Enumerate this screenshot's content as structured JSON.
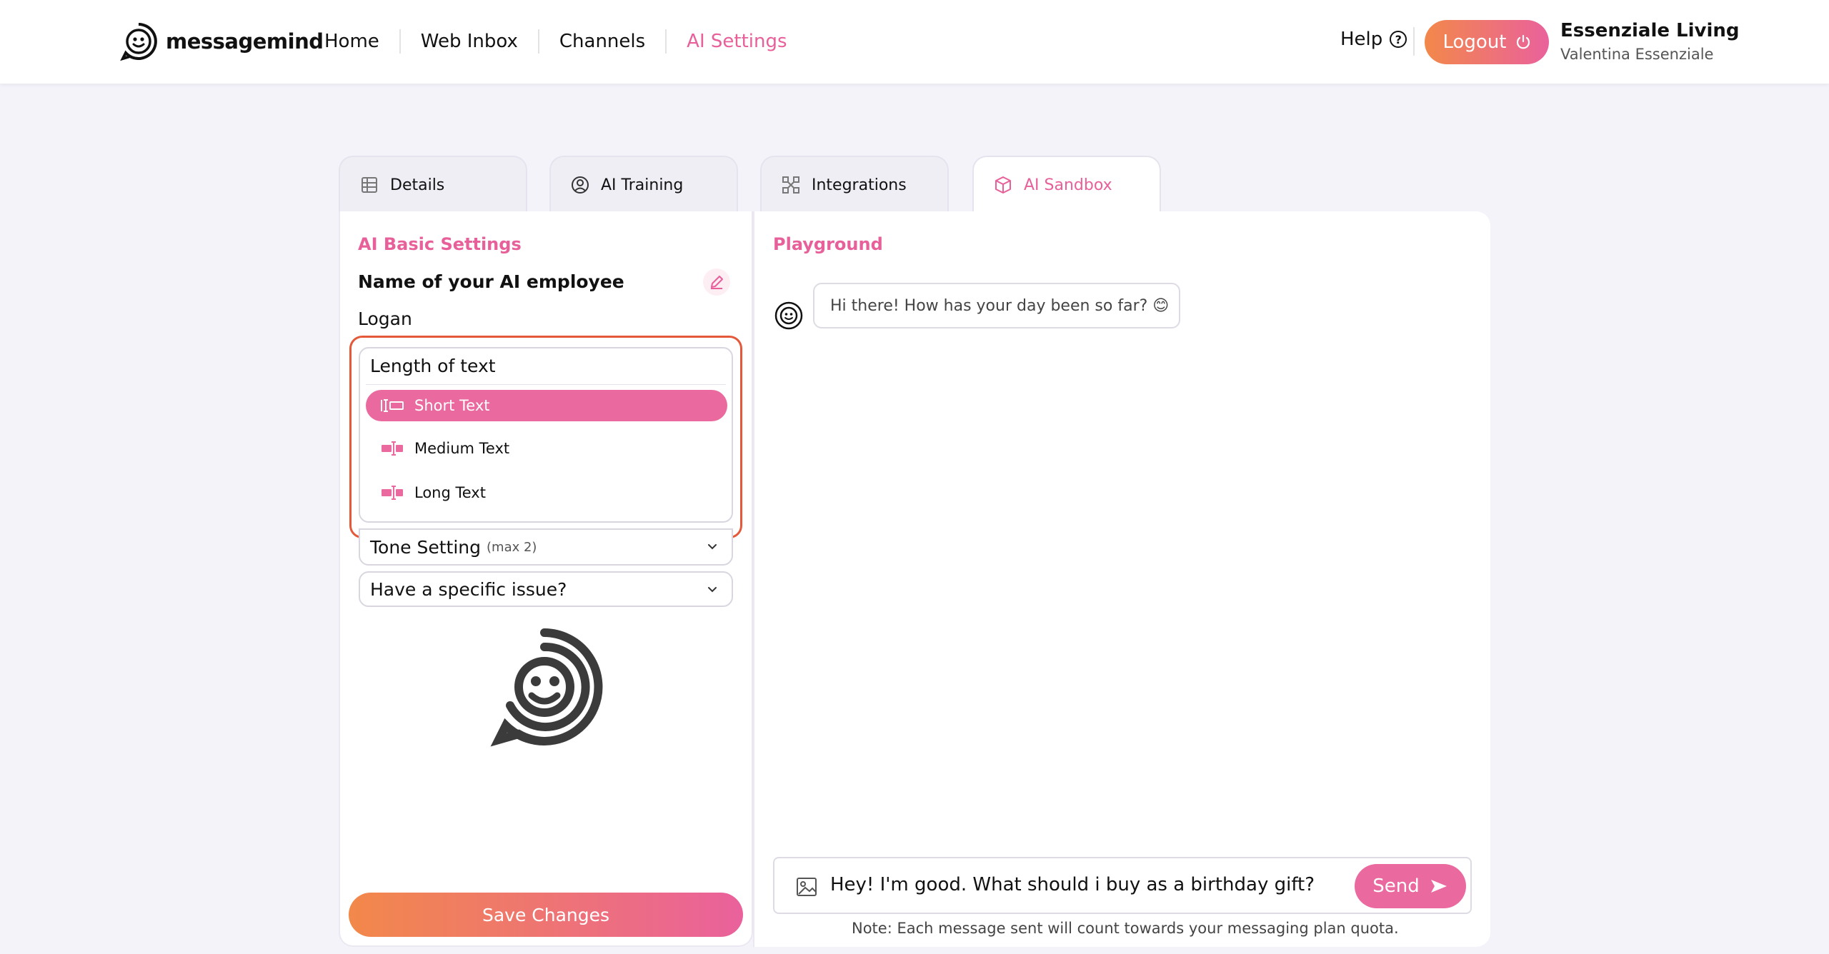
{
  "brand": {
    "name": "messagemind"
  },
  "nav": {
    "items": [
      "Home",
      "Web Inbox",
      "Channels",
      "AI Settings"
    ],
    "active": "AI Settings"
  },
  "header": {
    "help_label": "Help",
    "logout_label": "Logout",
    "user_company": "Essenziale Living",
    "user_name": "Valentina Essenziale"
  },
  "tabs": [
    {
      "label": "Details",
      "icon": "table-icon"
    },
    {
      "label": "AI Training",
      "icon": "user-circle-icon"
    },
    {
      "label": "Integrations",
      "icon": "integrations-icon"
    },
    {
      "label": "AI Sandbox",
      "icon": "cube-icon"
    }
  ],
  "left": {
    "section_title": "AI Basic Settings",
    "name_label": "Name of your AI employee",
    "name_value": "Logan",
    "length": {
      "title": "Length of text",
      "options": [
        "Short Text",
        "Medium Text",
        "Long Text"
      ],
      "selected": "Short Text"
    },
    "tone_label": "Tone Setting",
    "tone_hint": "(max 2)",
    "issue_label": "Have a specific issue?",
    "save_label": "Save Changes"
  },
  "playground": {
    "title": "Playground",
    "bot_message": "Hi there! How has your day been so far? 😊",
    "input_value": "Hey! I'm good. What should i buy as a birthday gift?",
    "send_label": "Send",
    "note": "Note: Each message sent will count towards your messaging plan quota."
  },
  "colors": {
    "accent": "#e8609a",
    "gradient_start": "#f2884a",
    "gradient_end": "#ea619c",
    "highlight": "#e4593a"
  }
}
